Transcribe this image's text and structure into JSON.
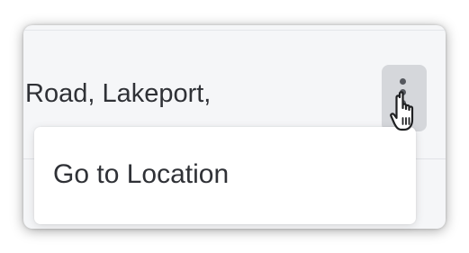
{
  "row": {
    "address_text": "Road, Lakeport,"
  },
  "menu_button": {
    "icon": "more-vertical-icon"
  },
  "dropdown": {
    "items": [
      {
        "label": "Go to Location"
      }
    ]
  },
  "cursor": {
    "icon": "hand-pointer-icon"
  },
  "colors": {
    "card_background": "#f5f6f8",
    "button_background": "#d5d7db",
    "text": "#2f3136",
    "dropdown_background": "#ffffff"
  }
}
